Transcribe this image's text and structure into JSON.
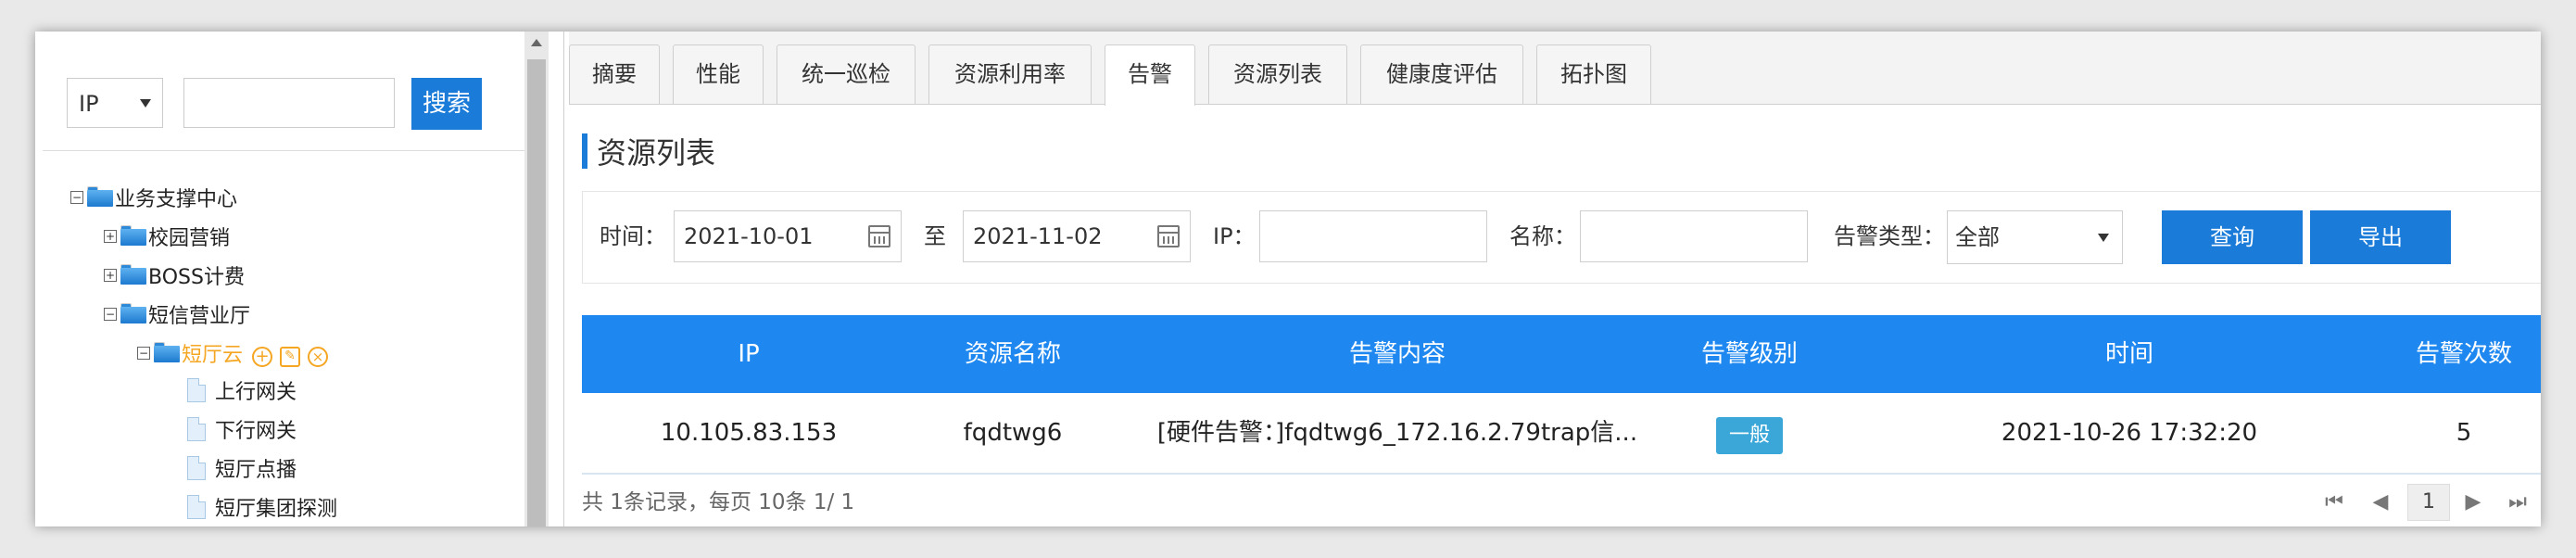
{
  "sidebar": {
    "search": {
      "type_value": "IP",
      "query_value": "",
      "button_label": "搜索"
    },
    "tree": {
      "root": {
        "label": "业务支撑中心",
        "toggle": "−"
      },
      "nodes": [
        {
          "label": "校园营销",
          "toggle": "+"
        },
        {
          "label": "BOSS计费",
          "toggle": "+"
        },
        {
          "label": "短信营业厅",
          "toggle": "−"
        }
      ],
      "selected": {
        "label": "短厅云",
        "toggle": "−",
        "actions": [
          "add-icon",
          "edit-icon",
          "delete-icon"
        ]
      },
      "leaves": [
        {
          "label": "上行网关"
        },
        {
          "label": "下行网关"
        },
        {
          "label": "短厅点播"
        },
        {
          "label": "短厅集团探测"
        }
      ]
    }
  },
  "tabs": [
    {
      "label": "摘要"
    },
    {
      "label": "性能"
    },
    {
      "label": "统一巡检"
    },
    {
      "label": "资源利用率"
    },
    {
      "label": "告警"
    },
    {
      "label": "资源列表"
    },
    {
      "label": "健康度评估"
    },
    {
      "label": "拓扑图"
    }
  ],
  "active_tab": "告警",
  "section_title": "资源列表",
  "filters": {
    "time_label": "时间：",
    "start_date": "2021-10-01",
    "to_label": "至",
    "end_date": "2021-11-02",
    "ip_label": "IP：",
    "ip_value": "",
    "name_label": "名称：",
    "name_value": "",
    "alarm_type_label": "告警类型：",
    "alarm_type_value": "全部",
    "query_button": "查询",
    "export_button": "导出"
  },
  "table": {
    "columns": [
      "IP",
      "资源名称",
      "告警内容",
      "告警级别",
      "时间",
      "告警次数"
    ],
    "rows": [
      {
        "ip": "10.105.83.153",
        "name": "fqdtwg6",
        "content": "[硬件告警：]fqdtwg6_172.16.2.79trap信...",
        "level": "一般",
        "time": "2021-10-26 17:32:20",
        "count": "5"
      }
    ]
  },
  "pagination": {
    "info": "共 1条记录，每页 10条   1/ 1",
    "current_page": "1"
  },
  "colors": {
    "accent": "#1a7bd8",
    "table_header": "#1e88f0",
    "badge": "#3aa7d8",
    "tree_action": "#f5a623"
  }
}
